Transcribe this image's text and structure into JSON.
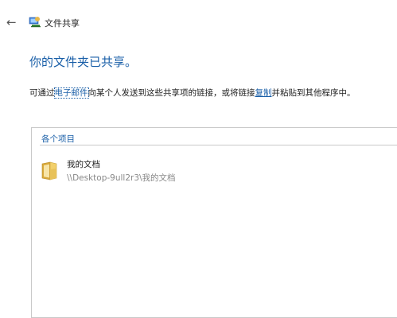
{
  "header": {
    "back_icon": "back-arrow-icon",
    "title_icon": "network-share-icon",
    "title": "文件共享"
  },
  "main": {
    "heading": "你的文件夹已共享。",
    "desc_part1": "可通过",
    "email_link": "电子邮件",
    "desc_part2": "向某个人发送到这些共享项的链接，或将链接",
    "copy_link": "复制",
    "desc_part3": "并粘贴到其他程序中。"
  },
  "items": {
    "header": "各个项目",
    "list": [
      {
        "icon": "folder-icon",
        "name": "我的文档",
        "path": "\\\\Desktop-9ull2r3\\我的文档"
      }
    ]
  },
  "colors": {
    "accent": "#1a5fa8",
    "muted_text": "#888888",
    "border": "#c9c9c9",
    "folder": "#e8c25a"
  }
}
